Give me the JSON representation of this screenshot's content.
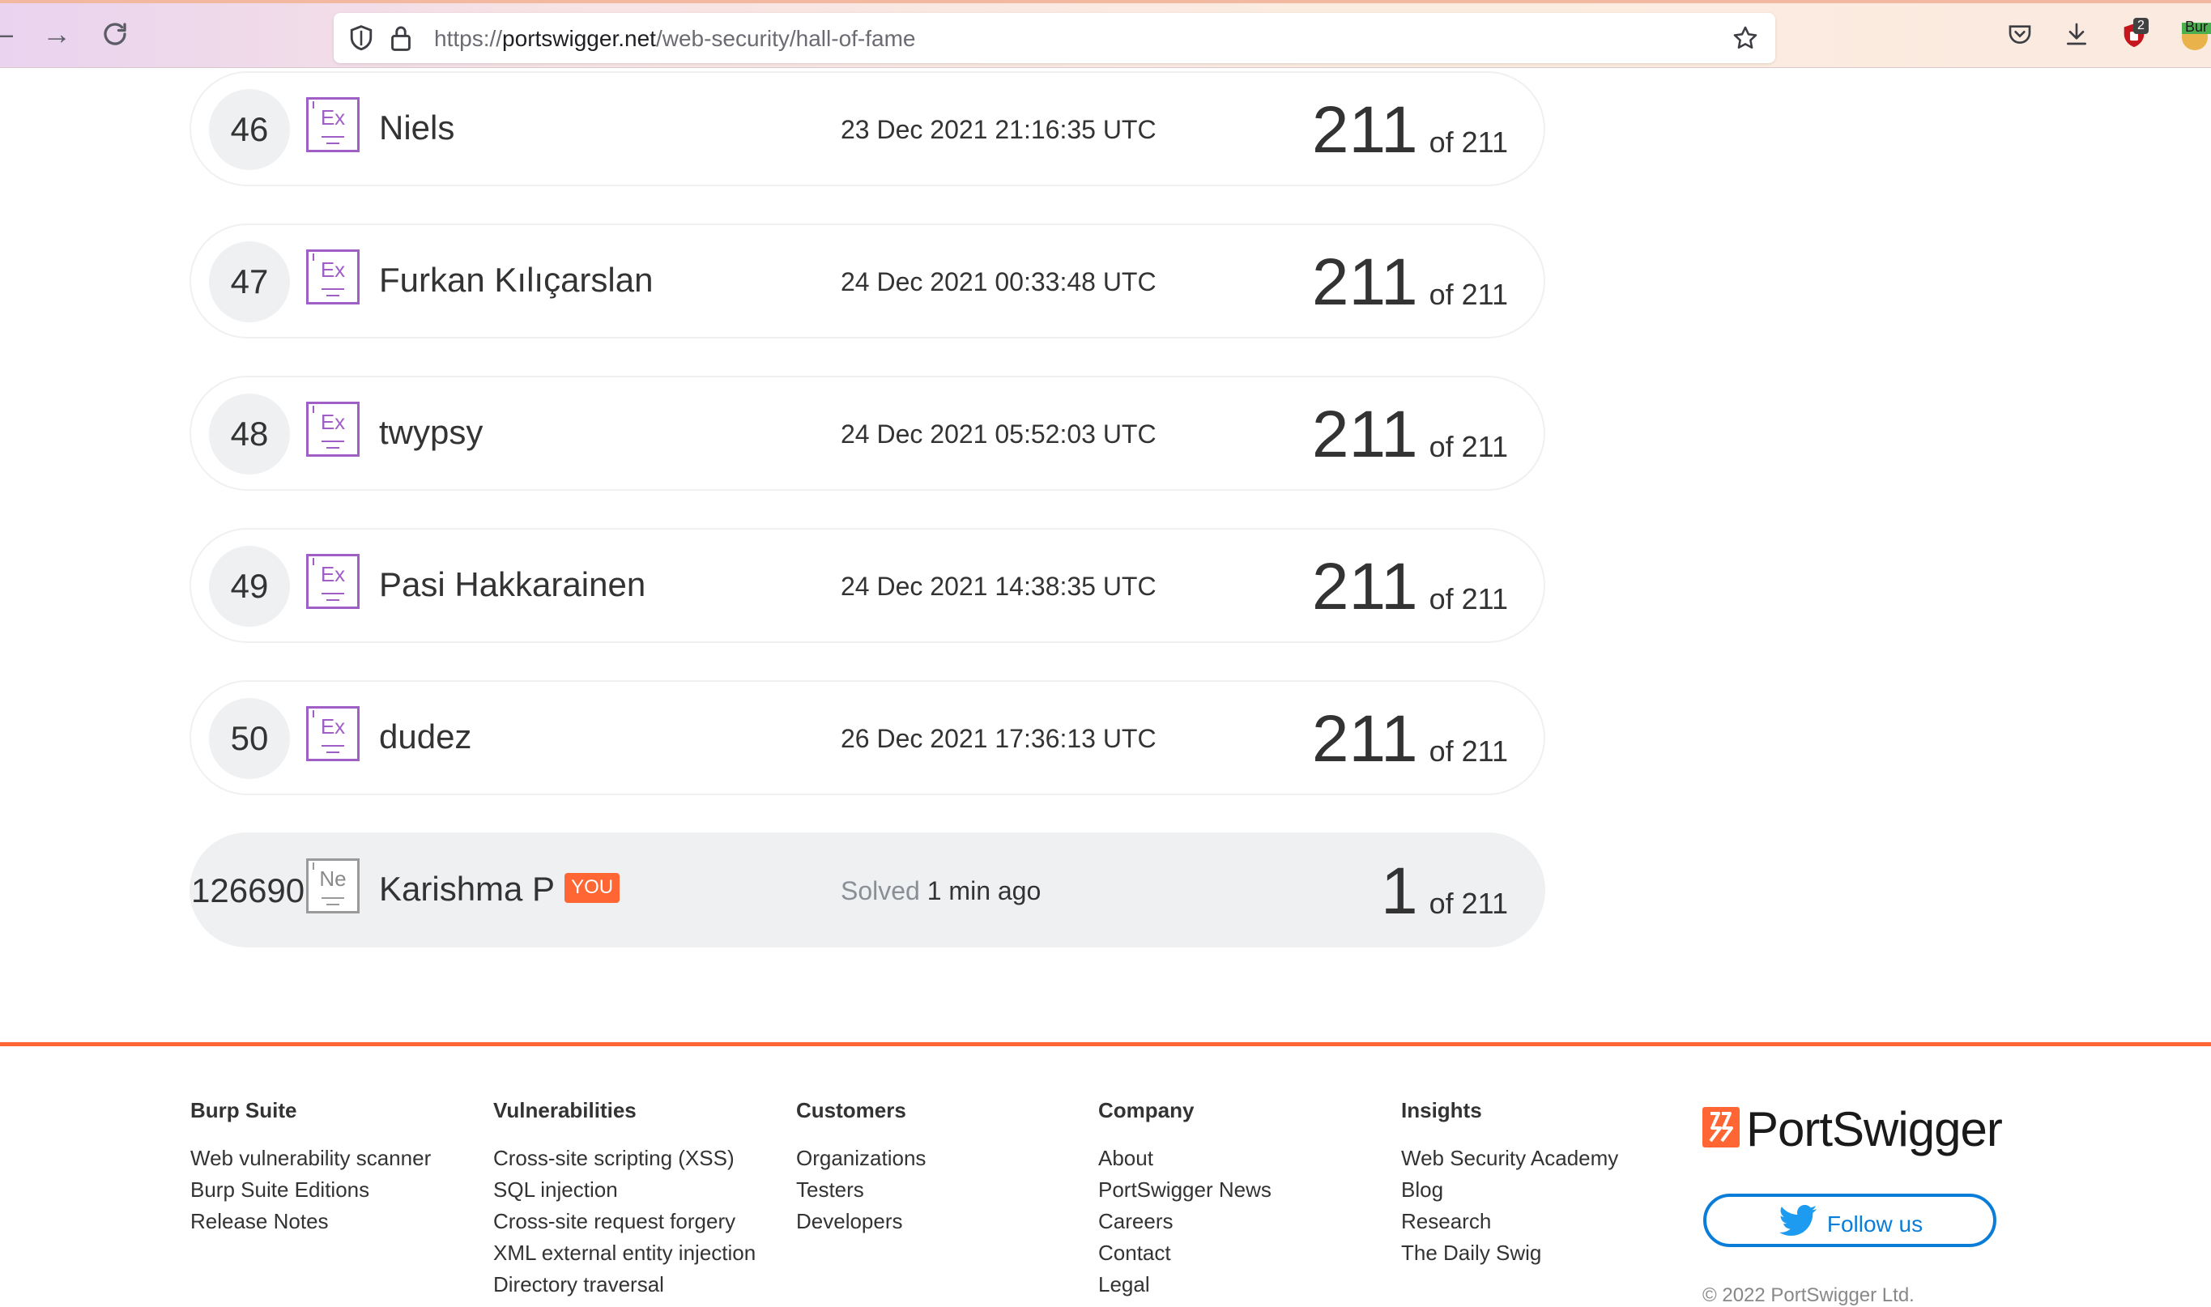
{
  "browser": {
    "url_scheme": "https://",
    "url_host": "portswigger.net",
    "url_path": "/web-security/hall-of-fame",
    "extension_badge": "2",
    "extension_label": "Bur"
  },
  "rows": [
    {
      "rank": "46",
      "level": "Ex",
      "name": "Niels",
      "date": "23 Dec 2021 21:16:35 UTC",
      "score": "211",
      "of": "of 211"
    },
    {
      "rank": "47",
      "level": "Ex",
      "name": "Furkan Kılıçarslan",
      "date": "24 Dec 2021 00:33:48 UTC",
      "score": "211",
      "of": "of 211"
    },
    {
      "rank": "48",
      "level": "Ex",
      "name": "twypsy",
      "date": "24 Dec 2021 05:52:03 UTC",
      "score": "211",
      "of": "of 211"
    },
    {
      "rank": "49",
      "level": "Ex",
      "name": "Pasi Hakkarainen",
      "date": "24 Dec 2021 14:38:35 UTC",
      "score": "211",
      "of": "of 211"
    },
    {
      "rank": "50",
      "level": "Ex",
      "name": "dudez",
      "date": "26 Dec 2021 17:36:13 UTC",
      "score": "211",
      "of": "of 211"
    }
  ],
  "you_row": {
    "rank": "126690",
    "level": "Ne",
    "name": "Karishma P",
    "badge": "YOU",
    "solved_label": "Solved",
    "solved_time": "1 min ago",
    "score": "1",
    "of": "of 211"
  },
  "footer": {
    "columns": [
      {
        "heading": "Burp Suite",
        "links": [
          "Web vulnerability scanner",
          "Burp Suite Editions",
          "Release Notes"
        ]
      },
      {
        "heading": "Vulnerabilities",
        "links": [
          "Cross-site scripting (XSS)",
          "SQL injection",
          "Cross-site request forgery",
          "XML external entity injection",
          "Directory traversal"
        ]
      },
      {
        "heading": "Customers",
        "links": [
          "Organizations",
          "Testers",
          "Developers"
        ]
      },
      {
        "heading": "Company",
        "links": [
          "About",
          "PortSwigger News",
          "Careers",
          "Contact",
          "Legal"
        ]
      },
      {
        "heading": "Insights",
        "links": [
          "Web Security Academy",
          "Blog",
          "Research",
          "The Daily Swig"
        ]
      }
    ],
    "logo_text": "PortSwigger",
    "follow_label": "Follow us",
    "copyright": "© 2022 PortSwigger Ltd."
  },
  "colors": {
    "accent": "#ff6633",
    "expert_purple": "#a05fc6",
    "twitter_blue": "#0a7dd8",
    "row_grey": "#eef0f2"
  }
}
